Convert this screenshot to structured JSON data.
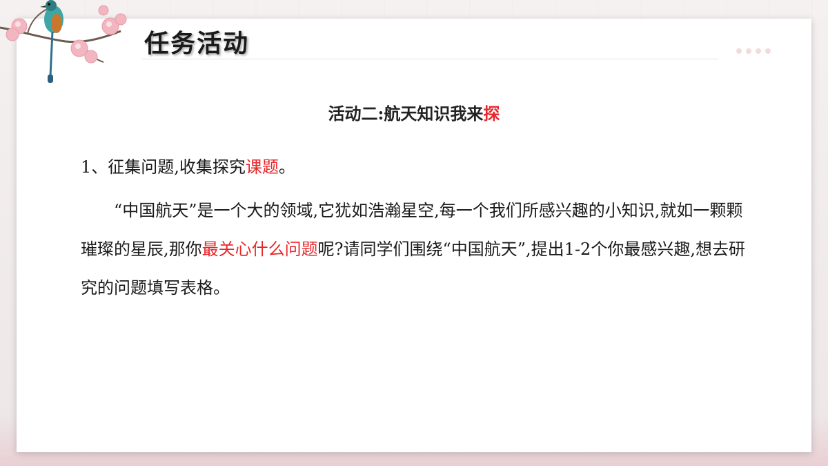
{
  "header": {
    "title": "任务活动"
  },
  "main": {
    "heading_prefix": "活动二:航天知识我来",
    "heading_highlight": "探",
    "item1_prefix": "1、征集问题,收集探究",
    "item1_highlight": "课题",
    "item1_suffix": "。",
    "paragraph_part1": "“中国航天”是一个大的领域,它犹如浩瀚星空,每一个我们所感兴趣的小知识,就如一颗颗璀璨的星辰,那你",
    "paragraph_highlight": "最关心什么问题",
    "paragraph_part2": "呢?请同学们围绕“中国航天”,提出1-2个你最感兴趣,想去研究的问题填写表格。"
  },
  "colors": {
    "highlight": "#e8262b",
    "text": "#1a1a1a",
    "blossom": "#f2b6c1"
  },
  "decorations": {
    "top_left": "bird-on-blossom-branch-icon",
    "top_right": "pagination-dots-icon"
  }
}
